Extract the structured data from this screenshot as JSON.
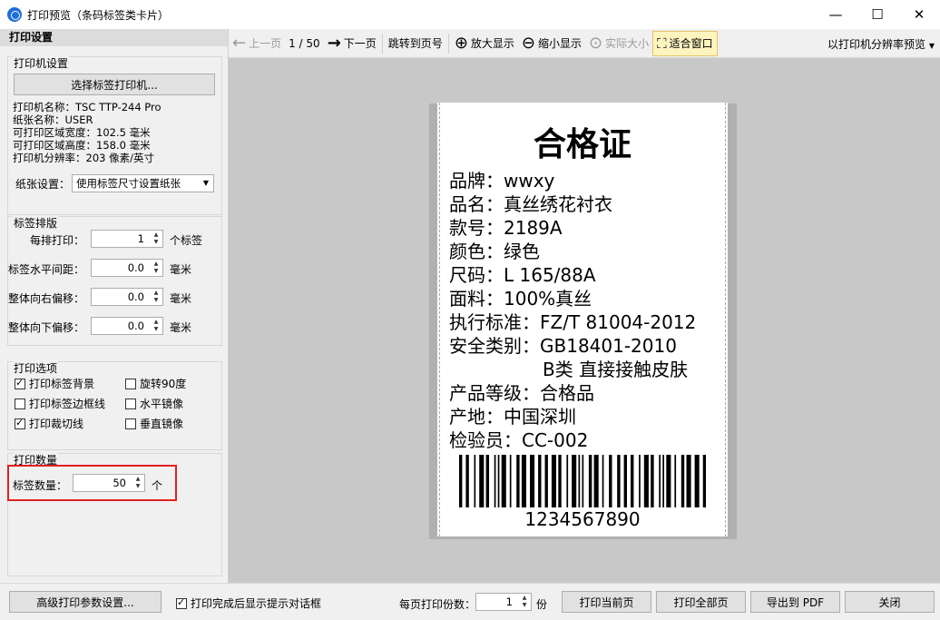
{
  "window": {
    "title": "打印预览（条码标签类卡片）",
    "minimize": "—",
    "maximize": "☐",
    "close": "✕"
  },
  "left_panel": {
    "header": "打印设置",
    "printer_group": {
      "title": "打印机设置",
      "select_button": "选择标签打印机...",
      "info": [
        "打印机名称：TSC TTP-244 Pro",
        "纸张名称：USER",
        "可打印区域宽度：102.5 毫米",
        "可打印区域高度：158.0 毫米",
        "打印机分辨率：203 像素/英寸"
      ],
      "paper_label": "纸张设置：",
      "paper_value": "使用标签尺寸设置纸张"
    },
    "layout_group": {
      "title": "标签排版",
      "rows": [
        {
          "label": "每排打印：",
          "value": "1",
          "unit": "个标签"
        },
        {
          "label": "标签水平间距：",
          "value": "0.0",
          "unit": "毫米"
        },
        {
          "label": "整体向右偏移：",
          "value": "0.0",
          "unit": "毫米"
        },
        {
          "label": "整体向下偏移：",
          "value": "0.0",
          "unit": "毫米"
        }
      ]
    },
    "options_group": {
      "title": "打印选项",
      "options": [
        {
          "label": "打印标签背景",
          "checked": true
        },
        {
          "label": "旋转90度",
          "checked": false
        },
        {
          "label": "打印标签边框线",
          "checked": false
        },
        {
          "label": "水平镜像",
          "checked": false
        },
        {
          "label": "打印裁切线",
          "checked": true
        },
        {
          "label": "垂直镜像",
          "checked": false
        }
      ]
    },
    "quantity_group": {
      "title": "打印数量",
      "label": "标签数量：",
      "value": "50",
      "unit": "个"
    }
  },
  "toolbar": {
    "prev_page": "上一页",
    "page_indicator": "1 / 50",
    "next_page": "下一页",
    "goto_page": "跳转到页号",
    "zoom_in": "放大显示",
    "zoom_out": "缩小显示",
    "actual_size": "实际大小",
    "fit_window": "适合窗口",
    "preview_mode": "以打印机分辨率预览"
  },
  "label": {
    "title": "合格证",
    "lines": [
      "品牌：wwxy",
      "品名：真丝绣花衬衣",
      "款号：2189A",
      "颜色：绿色",
      "尺码：L 165/88A",
      "面料：100%真丝",
      "执行标准：FZ/T 81004-2012",
      "安全类别：GB18401-2010",
      "B类 直接接触皮肤",
      "产品等级：合格品",
      "产地：中国深圳",
      "检验员：CC-002"
    ],
    "barcode_number": "1234567890"
  },
  "bottom_bar": {
    "advanced_button": "高级打印参数设置...",
    "show_dialog_label": "打印完成后显示提示对话框",
    "show_dialog_checked": true,
    "copies_label": "每页打印份数：",
    "copies_value": "1",
    "copies_unit": "份",
    "print_current": "打印当前页",
    "print_all": "打印全部页",
    "export_pdf": "导出到 PDF",
    "close": "关闭"
  }
}
